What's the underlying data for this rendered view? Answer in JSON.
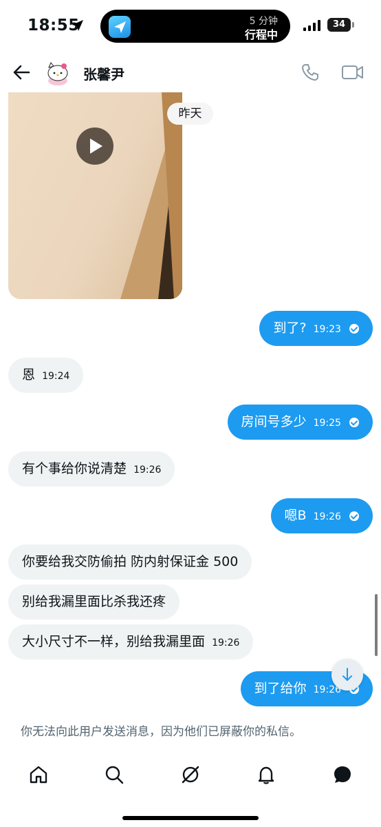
{
  "status_bar": {
    "time": "18:55",
    "island_line1": "5 分钟",
    "island_line2": "行程中",
    "battery": "34"
  },
  "header": {
    "contact_name": "张馨尹",
    "icons": [
      "back-arrow-icon",
      "avatar",
      "phone-icon",
      "video-camera-icon"
    ]
  },
  "thread": {
    "date_chip": "昨天",
    "messages": [
      {
        "from": "other",
        "type": "video"
      },
      {
        "from": "me",
        "text": "到了?",
        "time": "19:23"
      },
      {
        "from": "other",
        "text": "恩",
        "time": "19:24"
      },
      {
        "from": "me",
        "text": "房间号多少",
        "time": "19:25"
      },
      {
        "from": "other",
        "text": "有个事给你说清楚",
        "time": "19:26"
      },
      {
        "from": "me",
        "text": "嗯B",
        "time": "19:26"
      },
      {
        "from": "other",
        "text": "你要给我交防偷拍 防内射保证金 500",
        "time": ""
      },
      {
        "from": "other",
        "text": "别给我漏里面比杀我还疼",
        "time": ""
      },
      {
        "from": "other",
        "text": "大小尺寸不一样，别给我漏里面",
        "time": "19:26"
      },
      {
        "from": "me",
        "text": "到了给你",
        "time": "19:26"
      }
    ],
    "blocked_note": "你无法向此用户发送消息，因为他们已屏蔽你的私信。"
  },
  "tabbar": {
    "icons": [
      "home-icon",
      "search-icon",
      "grok-icon",
      "notifications-icon",
      "messages-icon"
    ]
  },
  "colors": {
    "accent": "#1d9bf0",
    "incoming_bubble": "#eff3f4",
    "muted_text": "#536471"
  }
}
